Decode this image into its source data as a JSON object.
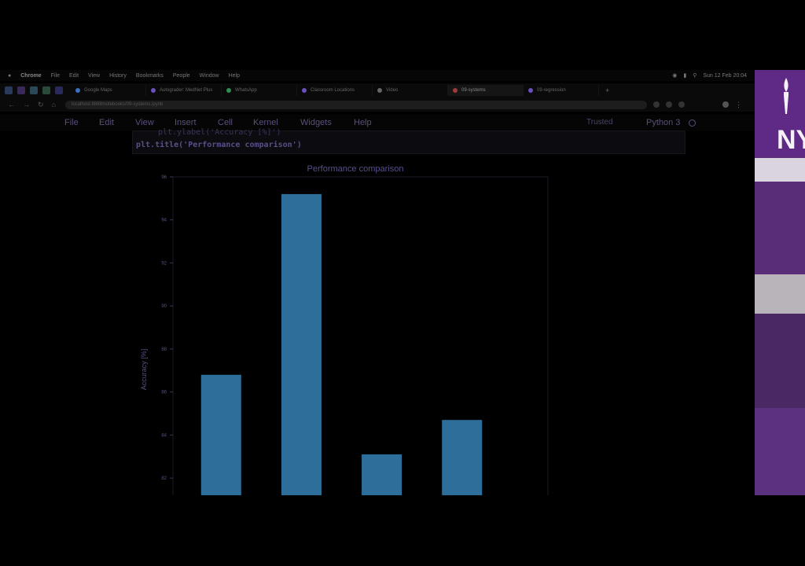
{
  "menubar": {
    "app": "Chrome",
    "items": [
      "File",
      "Edit",
      "View",
      "History",
      "Bookmarks",
      "People",
      "Window",
      "Help"
    ],
    "clock": "Sun 12 Feb 20:04"
  },
  "tabs": [
    {
      "label": "Google Maps",
      "color": "#3b6fbf"
    },
    {
      "label": "Autograder: MedNet Plus",
      "color": "#6a4fbf"
    },
    {
      "label": "WhatsApp",
      "color": "#2f8f4f"
    },
    {
      "label": "Classroom Locations",
      "color": "#6a4fbf"
    },
    {
      "label": "Video",
      "color": "#666666"
    },
    {
      "label": "09-systems",
      "color": "#a03a3a"
    },
    {
      "label": "09-regression",
      "color": "#6a4fbf"
    }
  ],
  "address": {
    "url": "localhost:8888/notebooks/09-systems.ipynb"
  },
  "jupyter": {
    "menu": [
      "File",
      "Edit",
      "View",
      "Insert",
      "Cell",
      "Kernel",
      "Widgets",
      "Help"
    ],
    "trusted": "Trusted",
    "kernel": "Python 3"
  },
  "code": {
    "prev_line": "plt.ylabel('Accuracy [%]')",
    "line": "plt.title('Performance comparison')"
  },
  "chart_data": {
    "type": "bar",
    "title": "Performance comparison",
    "xlabel": "",
    "ylabel": "Accuracy [%]",
    "categories": [
      "",
      "",
      "",
      ""
    ],
    "values": [
      86.8,
      95.2,
      83.1,
      84.7
    ],
    "ylim": [
      81.2,
      96
    ],
    "yticks": [
      82,
      84,
      86,
      88,
      90,
      92,
      94,
      96
    ],
    "bar_color": "#2d6f9a",
    "text_color": "#5b4f86",
    "grid": false
  },
  "webcam": {
    "logo_text": "NY"
  }
}
